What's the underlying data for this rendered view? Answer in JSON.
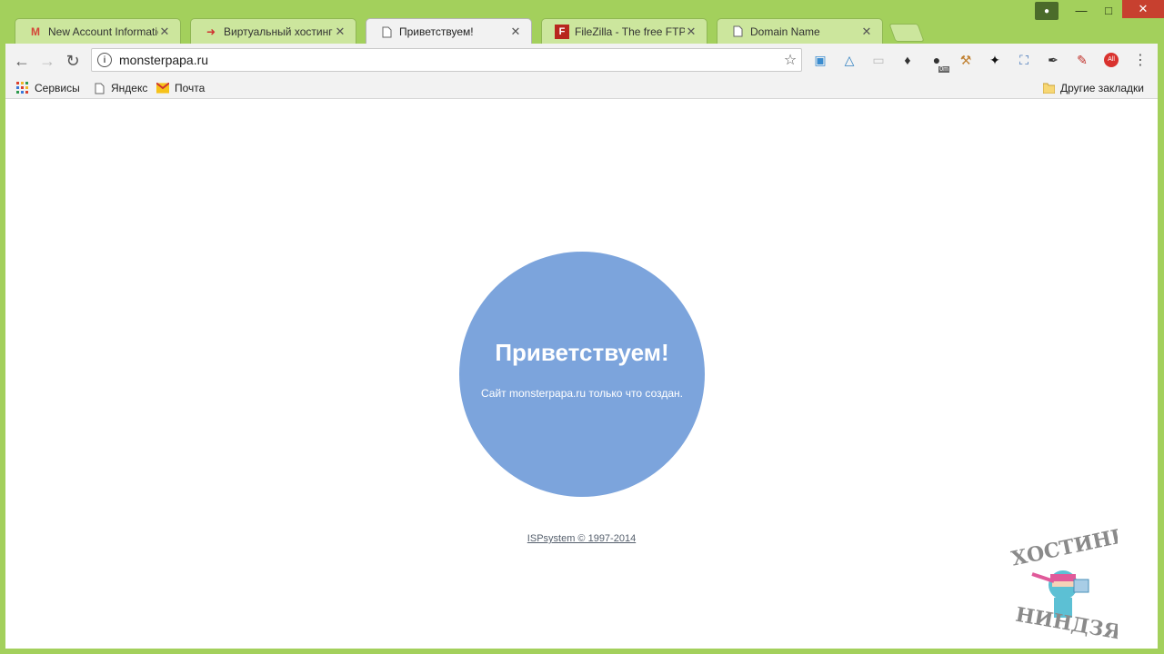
{
  "tabs": [
    {
      "title": "New Account Information",
      "favicon": "gmail-icon",
      "active": false
    },
    {
      "title": "Виртуальный хостинг сайтов",
      "favicon": "hoster-arrow-icon",
      "active": false
    },
    {
      "title": "Приветствуем!",
      "favicon": "page-icon",
      "active": true
    },
    {
      "title": "FileZilla - The free FTP solution",
      "favicon": "filezilla-icon",
      "active": false
    },
    {
      "title": "Domain Name",
      "favicon": "page-icon",
      "active": false
    }
  ],
  "omnibox": {
    "url": "monsterpapa.ru"
  },
  "bookmarks": {
    "items": [
      {
        "label": "Сервисы"
      },
      {
        "label": "Яндекс"
      },
      {
        "label": "Почта"
      }
    ],
    "other": "Другие закладки"
  },
  "page": {
    "heading": "Приветствуем!",
    "subtext": "Сайт monsterpapa.ru только что создан.",
    "footer_link": "ISPsystem © 1997-2014"
  },
  "extensions": {
    "badge": "0m",
    "abp_label": "All"
  },
  "watermark": {
    "top_text": "ХОСТИНГ",
    "bottom_text": "НИНДЗЯ"
  },
  "colors": {
    "frame": "#a3d05c",
    "circle": "#7ca4dc"
  }
}
